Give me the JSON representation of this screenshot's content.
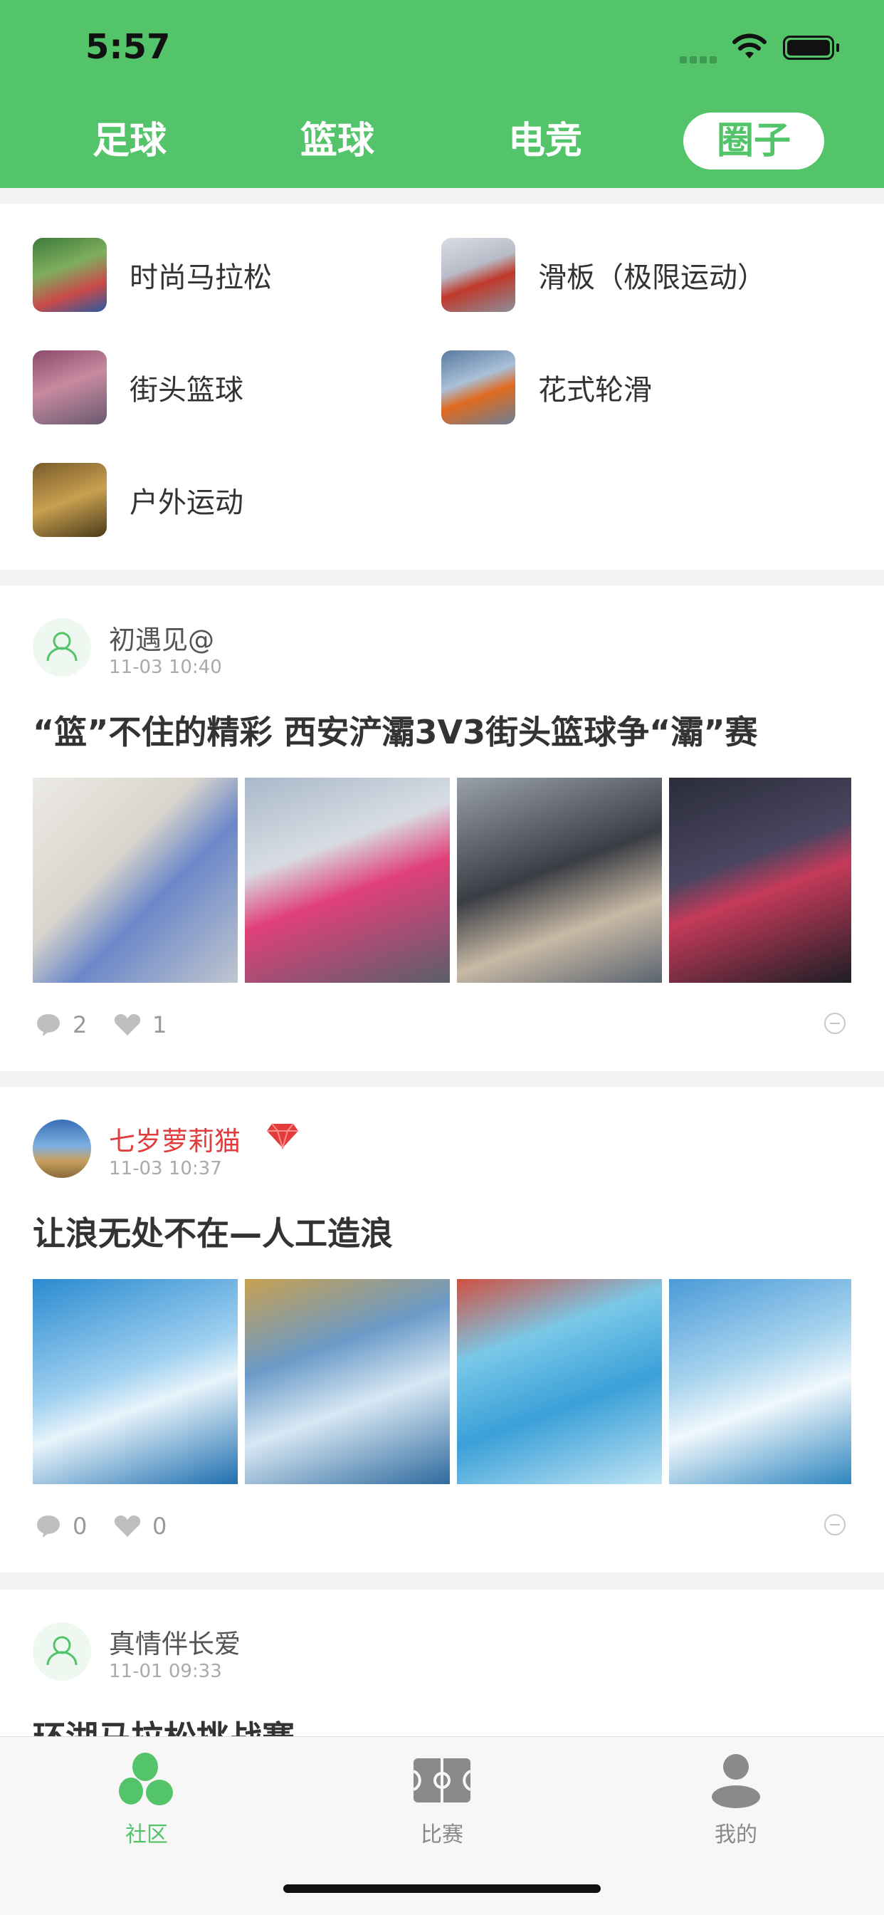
{
  "status_bar": {
    "time": "5:57"
  },
  "top_tabs": [
    {
      "label": "足球",
      "active": false
    },
    {
      "label": "篮球",
      "active": false
    },
    {
      "label": "电竞",
      "active": false
    },
    {
      "label": "圈子",
      "active": true
    }
  ],
  "circles": [
    {
      "name": "时尚马拉松",
      "icon": "marathon-thumbnail"
    },
    {
      "name": "滑板（极限运动）",
      "icon": "skateboard-thumbnail"
    },
    {
      "name": "街头篮球",
      "icon": "street-basketball-thumbnail"
    },
    {
      "name": "花式轮滑",
      "icon": "rollerskate-thumbnail"
    },
    {
      "name": "户外运动",
      "icon": "outdoor-thumbnail"
    }
  ],
  "posts": [
    {
      "username": "初遇见@",
      "time": "11-03 10:40",
      "title": "“篮”不住的精彩 西安浐灞3V3街头篮球争“灞”赛",
      "comments": "2",
      "likes": "1",
      "vip": false,
      "photos": [
        "basketball-photo-1",
        "basketball-photo-2",
        "basketball-photo-3",
        "basketball-photo-4"
      ]
    },
    {
      "username": "七岁萝莉猫",
      "time": "11-03 10:37",
      "title": "让浪无处不在—人工造浪",
      "comments": "0",
      "likes": "0",
      "vip": true,
      "photos": [
        "surf-photo-1",
        "surf-photo-2",
        "surf-photo-3",
        "surf-photo-4"
      ]
    },
    {
      "username": "真情伴长爱",
      "time": "11-01 09:33",
      "title": "环湖马拉松挑战赛",
      "vip": false
    }
  ],
  "bottom_tabs": [
    {
      "label": "社区",
      "icon": "community-icon",
      "active": true
    },
    {
      "label": "比赛",
      "icon": "match-icon",
      "active": false
    },
    {
      "label": "我的",
      "icon": "profile-icon",
      "active": false
    }
  ],
  "colors": {
    "brand": "#53c46a",
    "vip": "#e23c3c"
  }
}
